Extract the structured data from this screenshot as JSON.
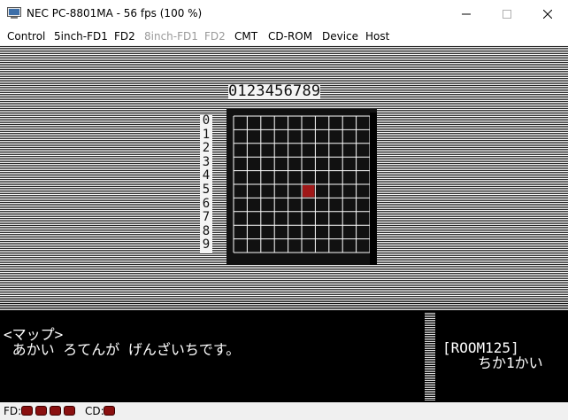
{
  "window": {
    "title": "NEC PC-8801MA - 56 fps (100 %)",
    "minimize_glyph": "—",
    "maximize_glyph": "☐",
    "close_glyph": "✕"
  },
  "menu": {
    "items": [
      {
        "label": "Control",
        "enabled": true
      },
      {
        "label": "5inch-FD1",
        "enabled": true
      },
      {
        "label": "FD2",
        "enabled": true
      },
      {
        "label": "8inch-FD1",
        "enabled": false
      },
      {
        "label": "FD2",
        "enabled": false
      },
      {
        "label": "CMT",
        "enabled": true
      },
      {
        "label": "CD-ROM",
        "enabled": true
      },
      {
        "label": "Device",
        "enabled": true
      },
      {
        "label": "Host",
        "enabled": true
      }
    ]
  },
  "game": {
    "column_labels": "0123456789",
    "row_labels": [
      "0",
      "1",
      "2",
      "3",
      "4",
      "5",
      "6",
      "7",
      "8",
      "9"
    ],
    "map": {
      "columns": 10,
      "rows": 10,
      "current_col": 5,
      "current_row": 5,
      "marker_color": "#a01818",
      "grid_color": "#ffffff",
      "background_color": "#000000"
    },
    "message": {
      "line1": "<マップ>",
      "line2": " あかい ろてんが げんざいちです。"
    },
    "room": {
      "line1": "[ROOM125]",
      "line2": "ちか1かい"
    }
  },
  "status": {
    "fd_label": "FD:",
    "fd_led_count": 4,
    "cd_label": "CD:",
    "cd_led_count": 1,
    "led_color": "#8a1010"
  }
}
